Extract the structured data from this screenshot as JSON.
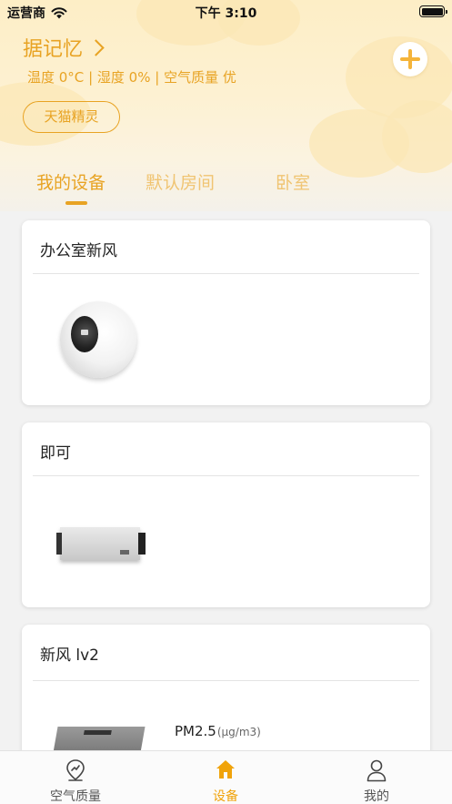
{
  "status_bar": {
    "carrier": "运营商",
    "time": "下午 3:10"
  },
  "header": {
    "home_name": "据记忆",
    "temperature": "温度 0°C",
    "humidity": "湿度 0%",
    "air_quality": "空气质量 优",
    "separator": " | ",
    "tmall_button": "天猫精灵"
  },
  "tabs": [
    {
      "label": "我的设备",
      "active": true
    },
    {
      "label": "默认房间",
      "active": false
    },
    {
      "label": "卧室",
      "active": false
    }
  ],
  "devices": [
    {
      "name": "办公室新风",
      "image": "spherical-air-purifier"
    },
    {
      "name": "即可",
      "image": "rectangular-ventilator-unit"
    },
    {
      "name": "新风 lv2",
      "image": "ventilator-unit",
      "pm_label": "PM2.5",
      "pm_unit": "(μg/m3)"
    }
  ],
  "bottom_nav": [
    {
      "label": "空气质量",
      "icon": "air-quality-icon",
      "active": false
    },
    {
      "label": "设备",
      "icon": "home-icon",
      "active": true
    },
    {
      "label": "我的",
      "icon": "user-icon",
      "active": false
    }
  ],
  "colors": {
    "accent": "#e8a323",
    "tab_inactive": "#f0c472",
    "nav_active": "#f0a30a",
    "background": "#f2f2f2"
  }
}
